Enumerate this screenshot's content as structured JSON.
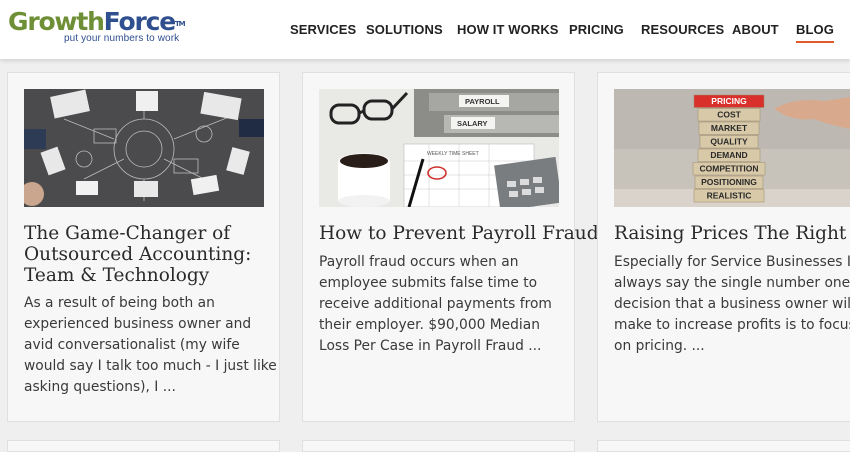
{
  "logo": {
    "part1": "Growth",
    "part2": "Force",
    "trademark": "TM",
    "tagline": "put your numbers to work"
  },
  "nav": {
    "items": [
      "SERVICES",
      "SOLUTIONS",
      "HOW IT WORKS",
      "PRICING",
      "RESOURCES",
      "ABOUT",
      "BLOG"
    ],
    "active": "BLOG"
  },
  "colors": {
    "accent": "#e05a2b",
    "brand_green": "#6e8f36",
    "brand_blue": "#2f4f8f"
  },
  "posts": [
    {
      "title_lines": [
        "The Game-Changer of",
        "Outsourced Accounting:",
        "Team & Technology"
      ],
      "excerpt_lines": [
        "As a result of being both an",
        "experienced business owner and",
        "avid conversationalist (my wife",
        "would say I talk too much - I just like",
        "asking questions), I ..."
      ]
    },
    {
      "title_lines": [
        "How to Prevent Payroll Fraud"
      ],
      "excerpt_lines": [
        "Payroll fraud occurs when an",
        "employee submits false time to",
        "receive additional payments from",
        "their employer. $90,000 Median",
        "Loss Per Case in Payroll Fraud ..."
      ],
      "image_text": {
        "folder1": "PAYROLL",
        "folder2": "SALARY",
        "sheet": "WEEKLY TIME SHEET"
      }
    },
    {
      "title_lines": [
        "Raising Prices The Right Way"
      ],
      "excerpt_lines": [
        "Especially for Service Businesses I",
        "always say the single number one",
        "decision that a business owner will",
        "make to increase profits is to focus",
        "on pricing. ..."
      ],
      "image_blocks": [
        "PRICING",
        "COST",
        "MARKET",
        "QUALITY",
        "DEMAND",
        "COMPETITION",
        "POSITIONING",
        "REALISTIC"
      ]
    }
  ]
}
